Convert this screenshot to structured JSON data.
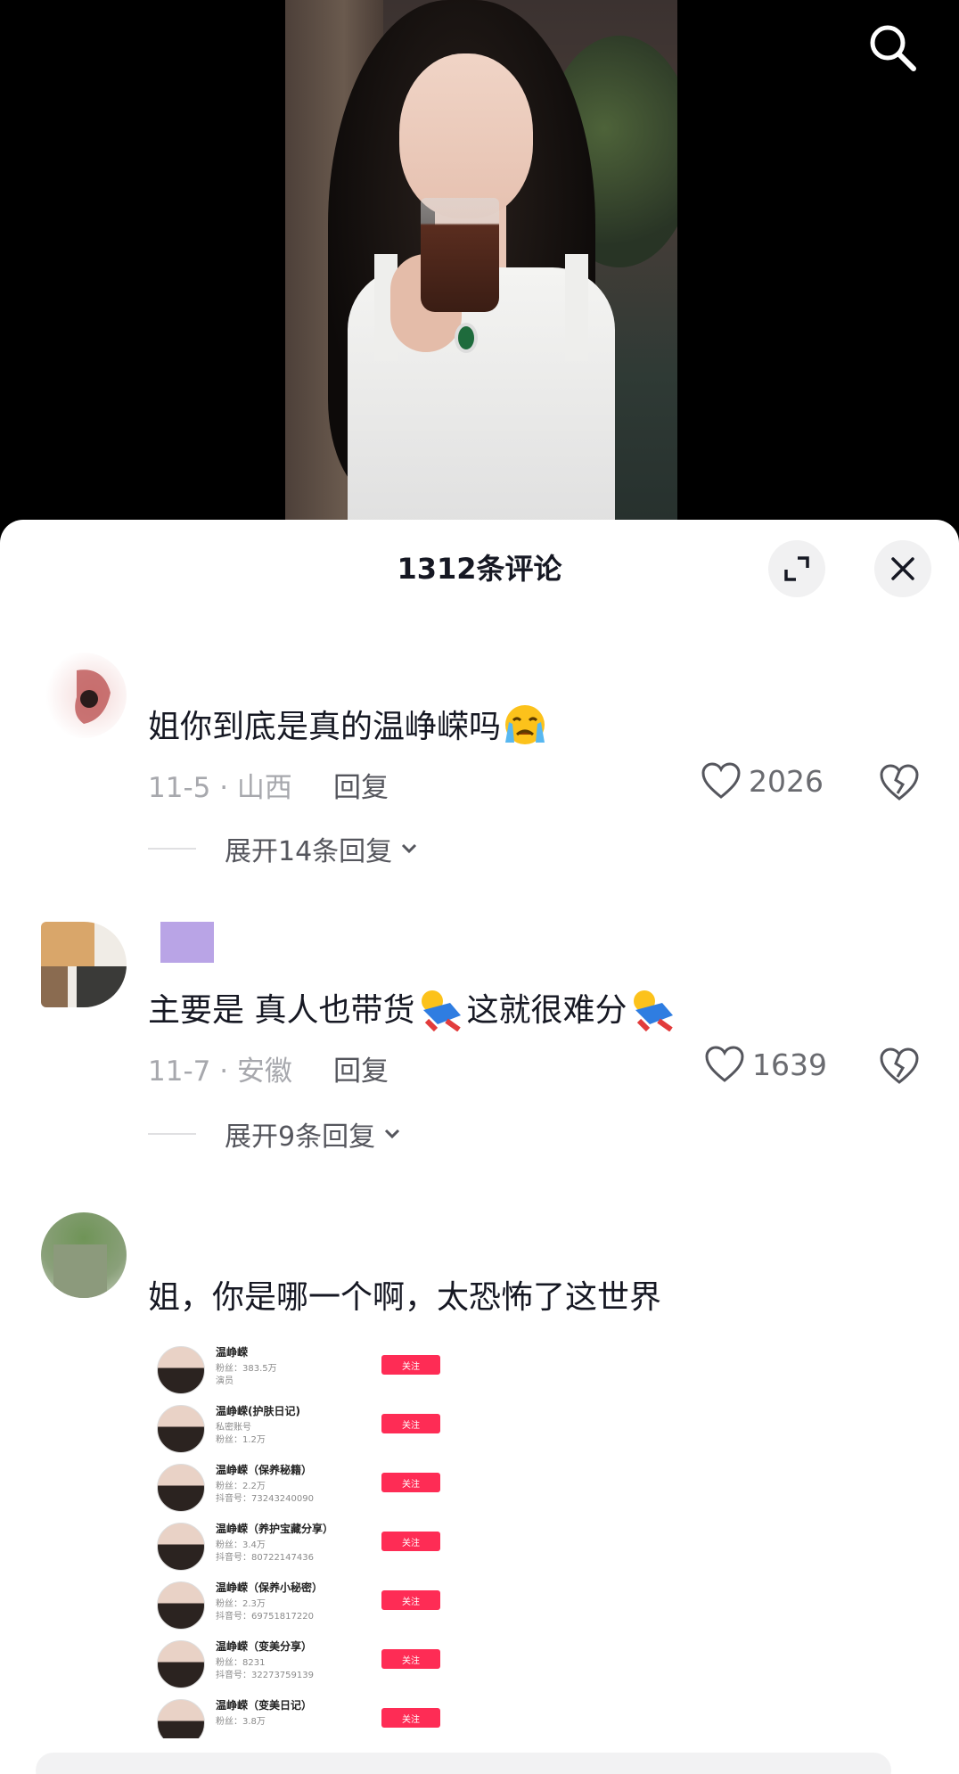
{
  "header": {
    "title": "1312条评论",
    "search_icon": "search-icon",
    "expand_icon": "expand-icon",
    "close_icon": "close-icon"
  },
  "comments": [
    {
      "text": "姐你到底是真的温峥嵘吗",
      "emoji": "crying-emoji",
      "date_location": "11-5 · 山西",
      "reply_label": "回复",
      "likes": "2026",
      "expand_label": "展开14条回复"
    },
    {
      "text_part1": "主要是 真人也带货",
      "text_part2": "这就很难分",
      "emoji": "rolling-laugh-emoji",
      "date_location": "11-7 · 安徽",
      "reply_label": "回复",
      "likes": "1639",
      "expand_label": "展开9条回复"
    },
    {
      "text": "姐，你是哪一个啊，太恐怖了这世界",
      "image": {
        "accounts": [
          {
            "name": "温峥嵘",
            "line1": "粉丝：383.5万",
            "line2": "演员",
            "follow": "关注"
          },
          {
            "name": "温峥嵘(护肤日记)",
            "line1": "私密账号",
            "line2": "粉丝：1.2万",
            "follow": "关注"
          },
          {
            "name": "温峥嵘（保养秘籍）",
            "line1": "粉丝：2.2万",
            "line2": "抖音号：73243240090",
            "follow": "关注"
          },
          {
            "name": "温峥嵘（养护宝藏分享）",
            "line1": "粉丝：3.4万",
            "line2": "抖音号：80722147436",
            "follow": "关注"
          },
          {
            "name": "温峥嵘（保养小秘密）",
            "line1": "粉丝：2.3万",
            "line2": "抖音号：69751817220",
            "follow": "关注"
          },
          {
            "name": "温峥嵘（变美分享）",
            "line1": "粉丝：8231",
            "line2": "抖音号：32273759139",
            "follow": "关注"
          },
          {
            "name": "温峥嵘（变美日记）",
            "line1": "粉丝：3.8万",
            "line2": "",
            "follow": "关注"
          }
        ]
      }
    }
  ],
  "colors": {
    "accent": "#fe2c55",
    "text": "#161823",
    "meta": "#a7a8ad"
  }
}
